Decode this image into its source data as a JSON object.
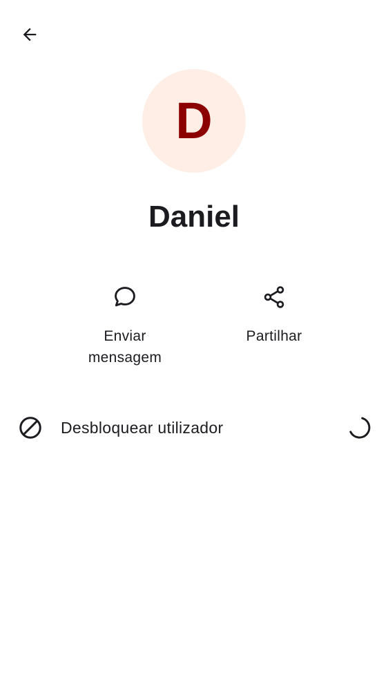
{
  "header": {
    "back_icon": "arrow-back-icon"
  },
  "contact": {
    "initial": "D",
    "name": "Daniel",
    "avatar_bg_color": "#ffeee6",
    "avatar_letter_color": "#8b0000"
  },
  "actions": [
    {
      "label": "Enviar\nmensagem",
      "icon": "chat-bubble-icon"
    },
    {
      "label": "Partilhar",
      "icon": "share-icon"
    }
  ],
  "unblock": {
    "label": "Desbloquear utilizador",
    "icon": "block-icon",
    "status_icon": "loading-spinner-icon"
  },
  "colors": {
    "text": "#1c1b1f",
    "background": "#ffffff"
  }
}
